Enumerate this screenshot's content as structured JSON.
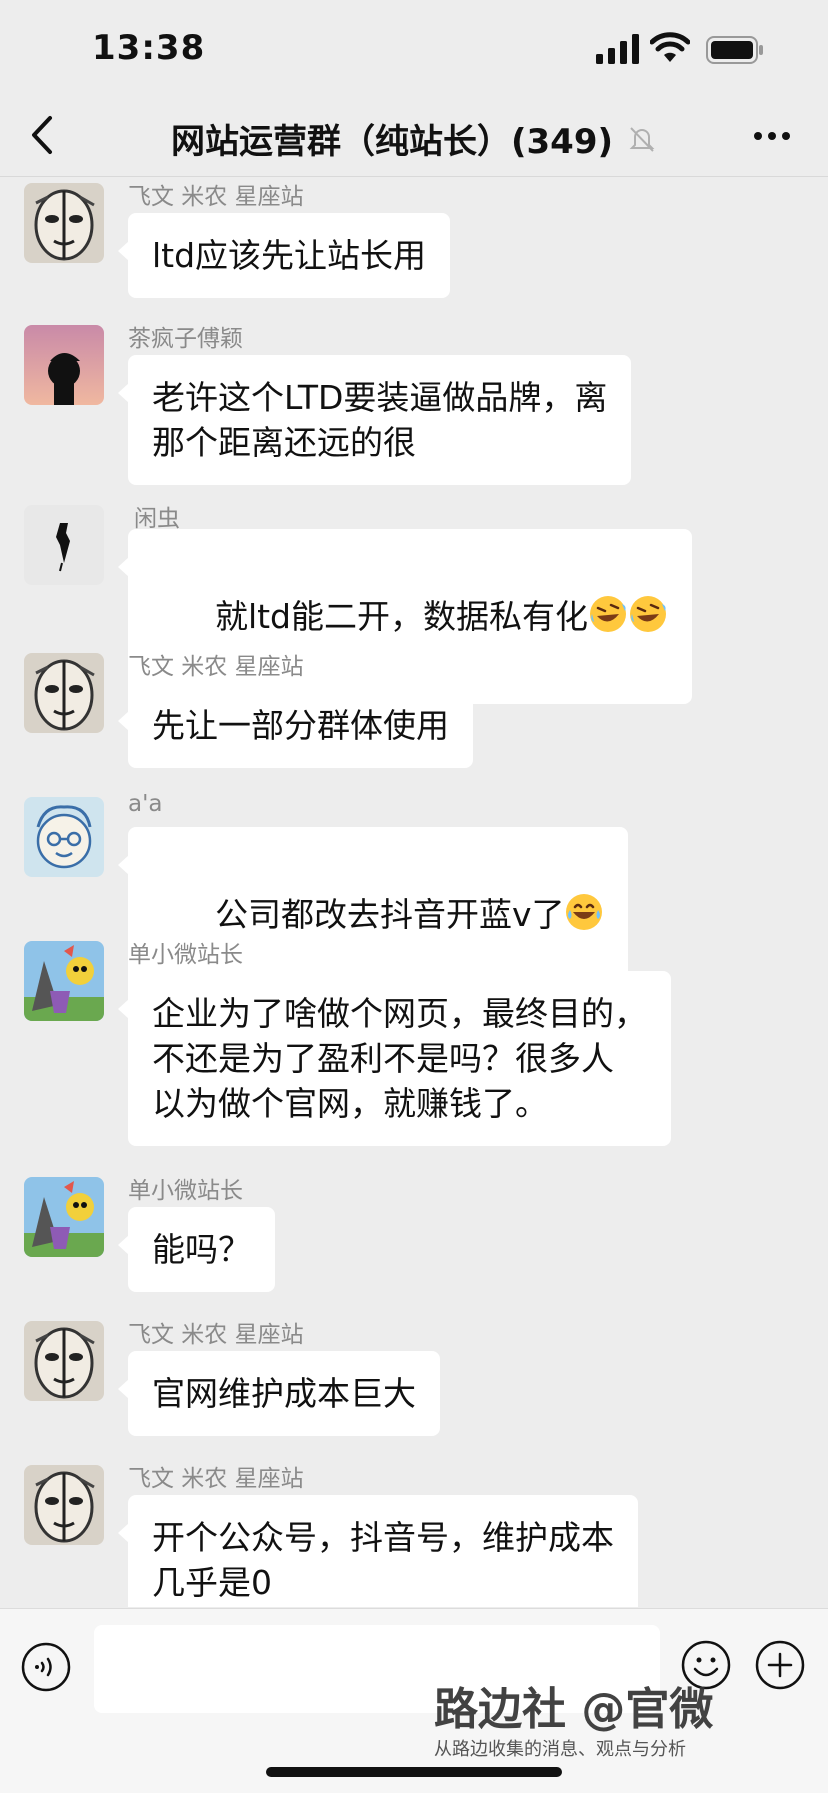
{
  "status_bar": {
    "time": "13:38"
  },
  "header": {
    "title": "网站运营群（纯站长）(349)"
  },
  "messages": [
    {
      "sender": "飞文 米农 星座站",
      "text": "ltd应该先让站长用",
      "avatar": "ink-face-avatar"
    },
    {
      "sender": "茶疯子傅颖",
      "text": "老许这个LTD要装逼做品牌，离\n那个距离还远的很",
      "avatar": "sunset-silhouette-avatar"
    },
    {
      "sender": "闲虫",
      "text": "就ltd能二开，数据私有化",
      "emoji": [
        "rolling-laugh-emoji",
        "rolling-laugh-emoji"
      ],
      "avatar": "ink-figure-avatar"
    },
    {
      "sender": "飞文 米农 星座站",
      "text": "先让一部分群体使用",
      "avatar": "ink-face-avatar"
    },
    {
      "sender": "a'a",
      "text": "公司都改去抖音开蓝v了",
      "emoji": [
        "tears-of-joy-emoji"
      ],
      "avatar": "cartoon-face-avatar"
    },
    {
      "sender": "单小微站长",
      "text": "企业为了啥做个网页，最终目的，\n不还是为了盈利不是吗？很多人\n以为做个官网，就赚钱了。",
      "avatar": "colorful-painting-avatar"
    },
    {
      "sender": "单小微站长",
      "text": "能吗？",
      "avatar": "colorful-painting-avatar"
    },
    {
      "sender": "飞文 米农 星座站",
      "text": "官网维护成本巨大",
      "avatar": "ink-face-avatar"
    },
    {
      "sender": "飞文 米农 星座站",
      "text": "开个公众号，抖音号，维护成本\n几乎是0",
      "avatar": "ink-face-avatar"
    }
  ],
  "input_bar": {
    "watermark_title": "路边社 @官微",
    "watermark_subtitle": "从路边收集的消息、观点与分析"
  },
  "colors": {
    "background": "#ededed",
    "bubble": "#ffffff",
    "sender": "#8a8a8a"
  }
}
